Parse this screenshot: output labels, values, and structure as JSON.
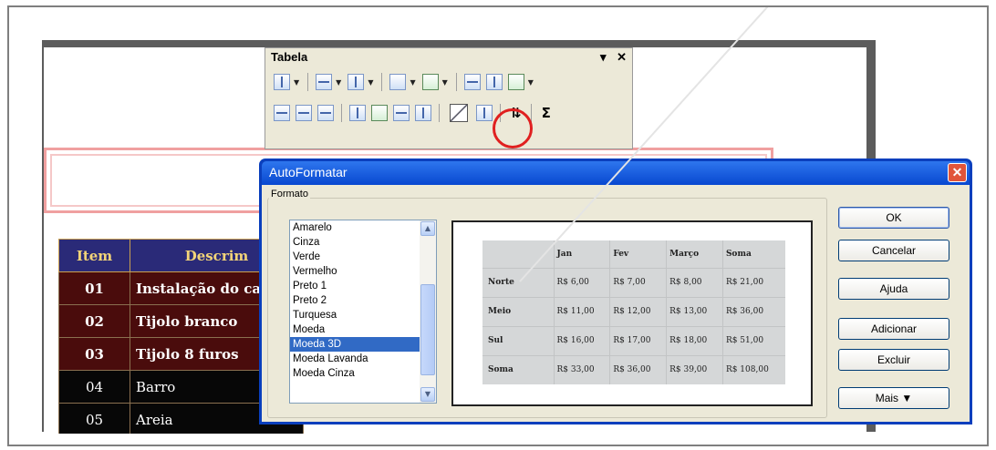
{
  "toolbar": {
    "title": "Tabela",
    "menu_glyph": "▾",
    "close_glyph": "✕",
    "sort_glyph": "⇅",
    "sum_glyph": "Σ"
  },
  "document_table": {
    "header": [
      "Item",
      "Descrim"
    ],
    "rows": [
      {
        "item": "01",
        "desc": "Instalação do ca",
        "style": "brown"
      },
      {
        "item": "02",
        "desc": "Tijolo branco",
        "style": "brown"
      },
      {
        "item": "03",
        "desc": "Tijolo 8 furos",
        "style": "brown"
      },
      {
        "item": "04",
        "desc": "Barro",
        "style": "black"
      },
      {
        "item": "05",
        "desc": "Areia",
        "style": "black"
      }
    ]
  },
  "dialog": {
    "title": "AutoFormatar",
    "close_glyph": "✕",
    "group_label": "Formato",
    "formats": [
      "Amarelo",
      "Cinza",
      "Verde",
      "Vermelho",
      "Preto 1",
      "Preto 2",
      "Turquesa",
      "Moeda",
      "Moeda 3D",
      "Moeda Lavanda",
      "Moeda Cinza"
    ],
    "selected_format": "Moeda 3D",
    "scroll_up": "▲",
    "scroll_down": "▼",
    "preview": {
      "columns": [
        "",
        "Jan",
        "Fev",
        "Março",
        "Soma"
      ],
      "rows": [
        {
          "label": "Norte",
          "values": [
            "R$ 6,00",
            "R$ 7,00",
            "R$ 8,00",
            "R$ 21,00"
          ]
        },
        {
          "label": "Meio",
          "values": [
            "R$ 11,00",
            "R$ 12,00",
            "R$ 13,00",
            "R$ 36,00"
          ]
        },
        {
          "label": "Sul",
          "values": [
            "R$ 16,00",
            "R$ 17,00",
            "R$ 18,00",
            "R$ 51,00"
          ]
        },
        {
          "label": "Soma",
          "values": [
            "R$ 33,00",
            "R$ 36,00",
            "R$ 39,00",
            "R$ 108,00"
          ]
        }
      ]
    },
    "buttons": {
      "ok": "OK",
      "cancel": "Cancelar",
      "help": "Ajuda",
      "add": "Adicionar",
      "delete": "Excluir",
      "more": "Mais ▼"
    }
  }
}
